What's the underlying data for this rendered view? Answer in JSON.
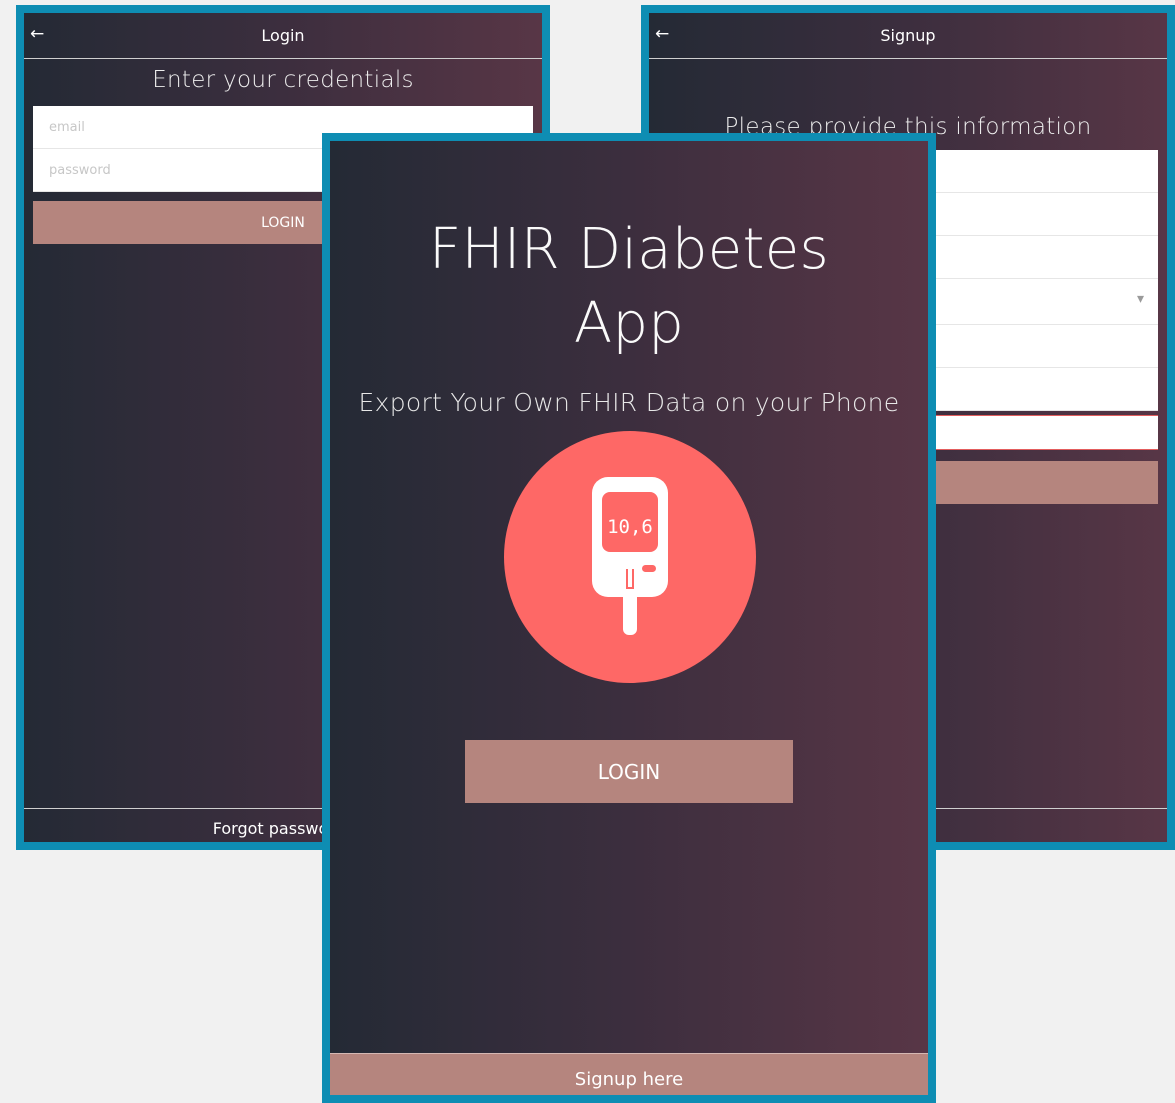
{
  "login_screen": {
    "title": "Login",
    "back_icon": "←",
    "heading": "Enter your credentials",
    "email_placeholder": "email",
    "password_placeholder": "password",
    "login_button": "LOGIN",
    "forgot_link": "Forgot password?"
  },
  "signup_screen": {
    "title": "Signup",
    "back_icon": "←",
    "heading": "Please provide this information",
    "dropdown_icon": "▾"
  },
  "main_screen": {
    "title_line1": "FHIR Diabetes",
    "title_line2": "App",
    "subtitle": "Export Your Own FHIR Data on your Phone",
    "meter_reading": "10,6",
    "login_button": "LOGIN",
    "signup_link": "Signup here"
  },
  "colors": {
    "frame": "#0e8db3",
    "button": "#b5857e",
    "icon_circle": "#fe6866",
    "gradient_start": "#242a35",
    "gradient_end": "#583646"
  }
}
